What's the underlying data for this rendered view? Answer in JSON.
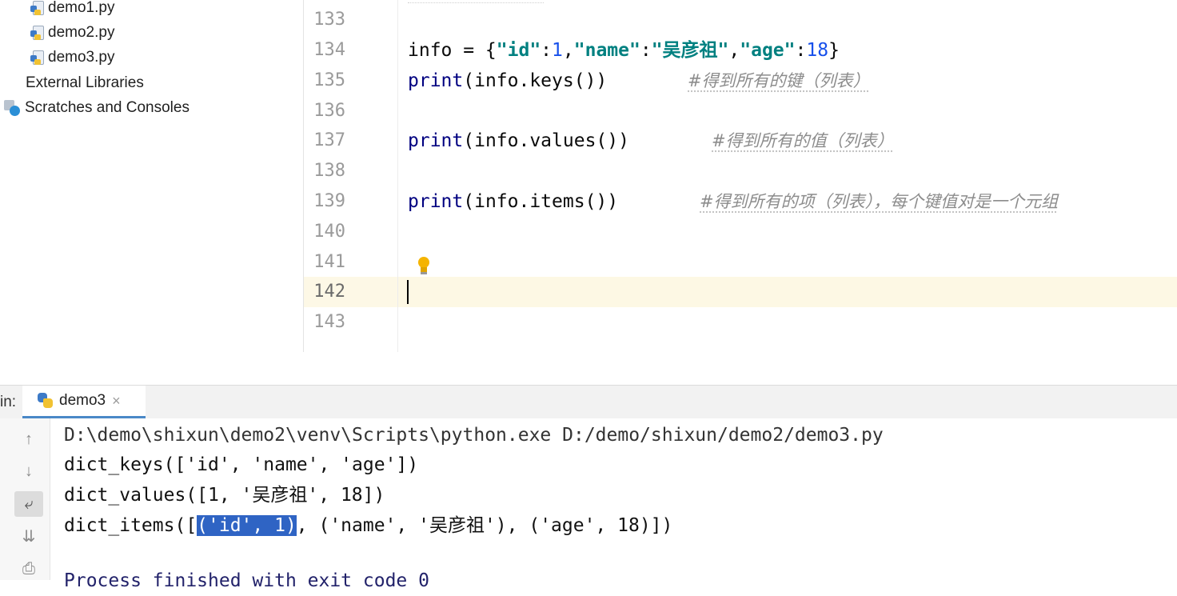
{
  "project_tree": {
    "files": [
      {
        "name": "demo1.py",
        "icon": "python-file-icon"
      },
      {
        "name": "demo2.py",
        "icon": "python-file-icon"
      },
      {
        "name": "demo3.py",
        "icon": "python-file-icon"
      }
    ],
    "external_libraries": "External Libraries",
    "scratches": "Scratches and Consoles"
  },
  "editor": {
    "line_numbers": [
      "133",
      "134",
      "135",
      "136",
      "137",
      "138",
      "139",
      "140",
      "141",
      "142",
      "143"
    ],
    "active_line": "142",
    "code": {
      "line134": {
        "var": "info",
        "op": " = {",
        "k1": "\"id\"",
        "c1": ":",
        "v1": "1",
        "comma1": ",",
        "k2": "\"name\"",
        "c2": ":",
        "v2": "\"吴彦祖\"",
        "comma2": ",",
        "k3": "\"age\"",
        "c3": ":",
        "v3": "18",
        "close": "}"
      },
      "line135": {
        "fn": "print",
        "rest": "(info.keys())",
        "comment": "#得到所有的键（列表）"
      },
      "line137": {
        "fn": "print",
        "rest": "(info.values())",
        "comment": "#得到所有的值（列表）"
      },
      "line139": {
        "fn": "print",
        "rest": "(info.items())",
        "comment": "#得到所有的项（列表），每个键值对是一个元组"
      }
    }
  },
  "run_panel": {
    "label": "in:",
    "tab": {
      "name": "demo3",
      "close": "×"
    },
    "toolbar_icons": [
      "arrow-up-icon",
      "arrow-down-icon",
      "soft-wrap-icon",
      "scroll-to-end-icon",
      "print-icon"
    ],
    "output": {
      "cmd": "D:\\demo\\shixun\\demo2\\venv\\Scripts\\python.exe D:/demo/shixun/demo2/demo3.py",
      "keys": "dict_keys(['id', 'name', 'age'])",
      "values": "dict_values([1, '吴彦祖', 18])",
      "items_prefix": "dict_items([",
      "items_selected": "('id', 1)",
      "items_suffix": ", ('name', '吴彦祖'), ('age', 18)])",
      "finished": "Process finished with exit code 0"
    }
  },
  "colors": {
    "keyword": "#000080",
    "string": "#008080",
    "number": "#1750eb",
    "comment": "#8c8c8c",
    "selection": "#2f64c4",
    "current_line": "#fdf8e4"
  }
}
